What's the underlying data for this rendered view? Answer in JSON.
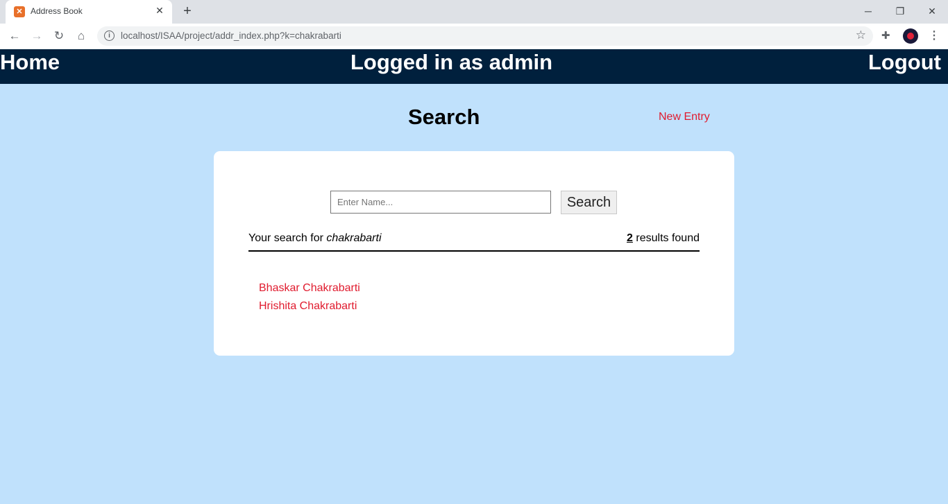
{
  "browser": {
    "tab_title": "Address Book",
    "url": "localhost/ISAA/project/addr_index.php?k=chakrabarti"
  },
  "navbar": {
    "home_label": "Home",
    "user_label": "Logged in as admin",
    "logout_label": "Logout"
  },
  "header": {
    "title": "Search",
    "new_entry_label": "New Entry"
  },
  "search": {
    "placeholder": "Enter Name...",
    "value": "",
    "button_label": "Search",
    "summary_prefix": "Your search for ",
    "query": "chakrabarti",
    "result_count": "2",
    "results_suffix": " results found"
  },
  "results": [
    {
      "name": "Bhaskar Chakrabarti"
    },
    {
      "name": "Hrishita Chakrabarti"
    }
  ],
  "colors": {
    "navbar_bg": "#00203d",
    "page_bg": "#c0e1fc",
    "link": "#e01b2e"
  }
}
